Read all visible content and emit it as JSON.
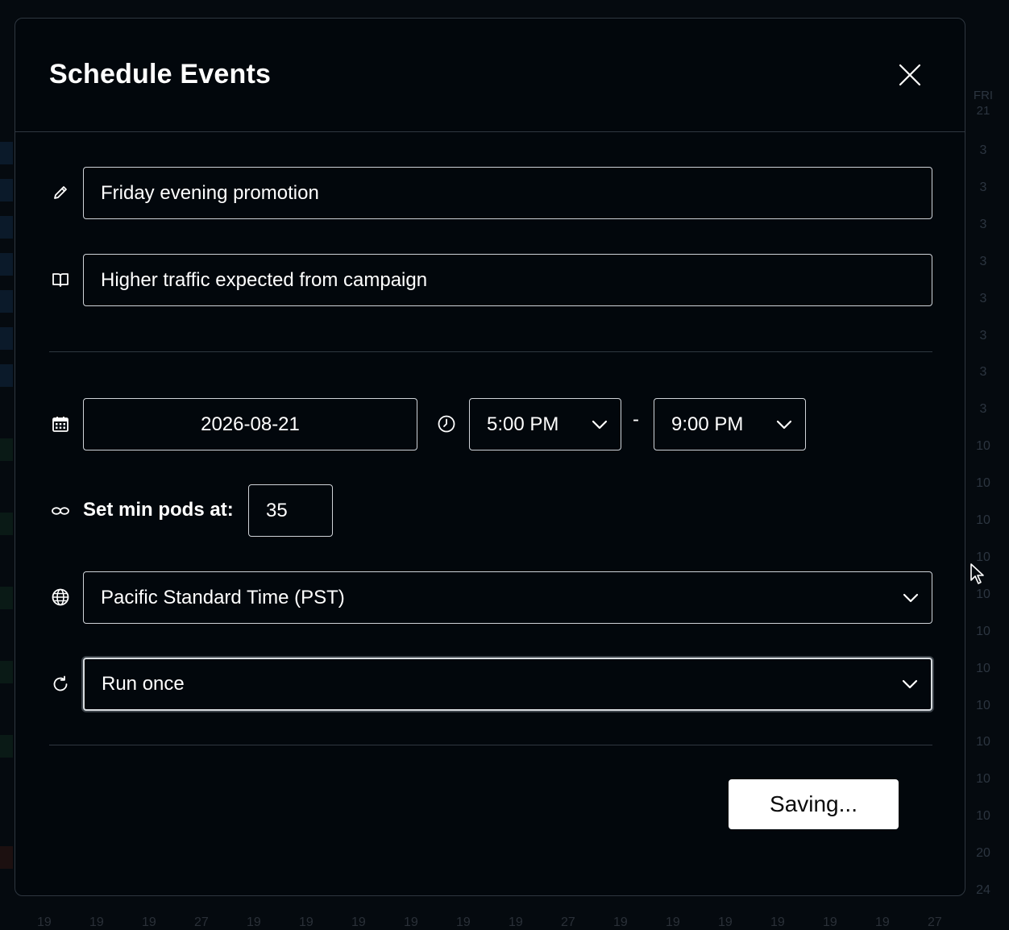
{
  "background": {
    "column_day": "FRI",
    "column_date": "21",
    "column_values": [
      "3",
      "3",
      "3",
      "3",
      "3",
      "3",
      "3",
      "3",
      "10",
      "10",
      "10",
      "10",
      "10",
      "10",
      "10",
      "10",
      "10",
      "10",
      "10",
      "20",
      "24"
    ],
    "bottom_values": [
      "19",
      "19",
      "19",
      "27",
      "19",
      "19",
      "19",
      "19",
      "19",
      "19",
      "27",
      "19",
      "19",
      "19",
      "19",
      "19",
      "19",
      "27"
    ]
  },
  "modal": {
    "title": "Schedule Events",
    "name_value": "Friday evening promotion",
    "description_value": "Higher traffic expected from campaign",
    "date_value": "2026-08-21",
    "start_time": "5:00 PM",
    "time_separator": "-",
    "end_time": "9:00 PM",
    "min_pods_label": "Set min pods at:",
    "min_pods_value": "35",
    "timezone": "Pacific Standard Time (PST)",
    "recurrence": "Run once",
    "save_button": "Saving..."
  },
  "icons": {
    "name": "pencil-icon",
    "description": "book-icon",
    "date": "calendar-icon",
    "time": "clock-icon",
    "pods": "pods-icon",
    "timezone": "globe-icon",
    "recurrence": "repeat-icon",
    "close": "close-icon",
    "dropdown": "chevron-down-icon"
  },
  "colors": {
    "background": "#050a0f",
    "modal_background": "#02070c",
    "border": "#2f3740",
    "field_border": "#cfd3d8",
    "text": "#ffffff",
    "button_background": "#ffffff",
    "button_text": "#0a0a0a"
  }
}
